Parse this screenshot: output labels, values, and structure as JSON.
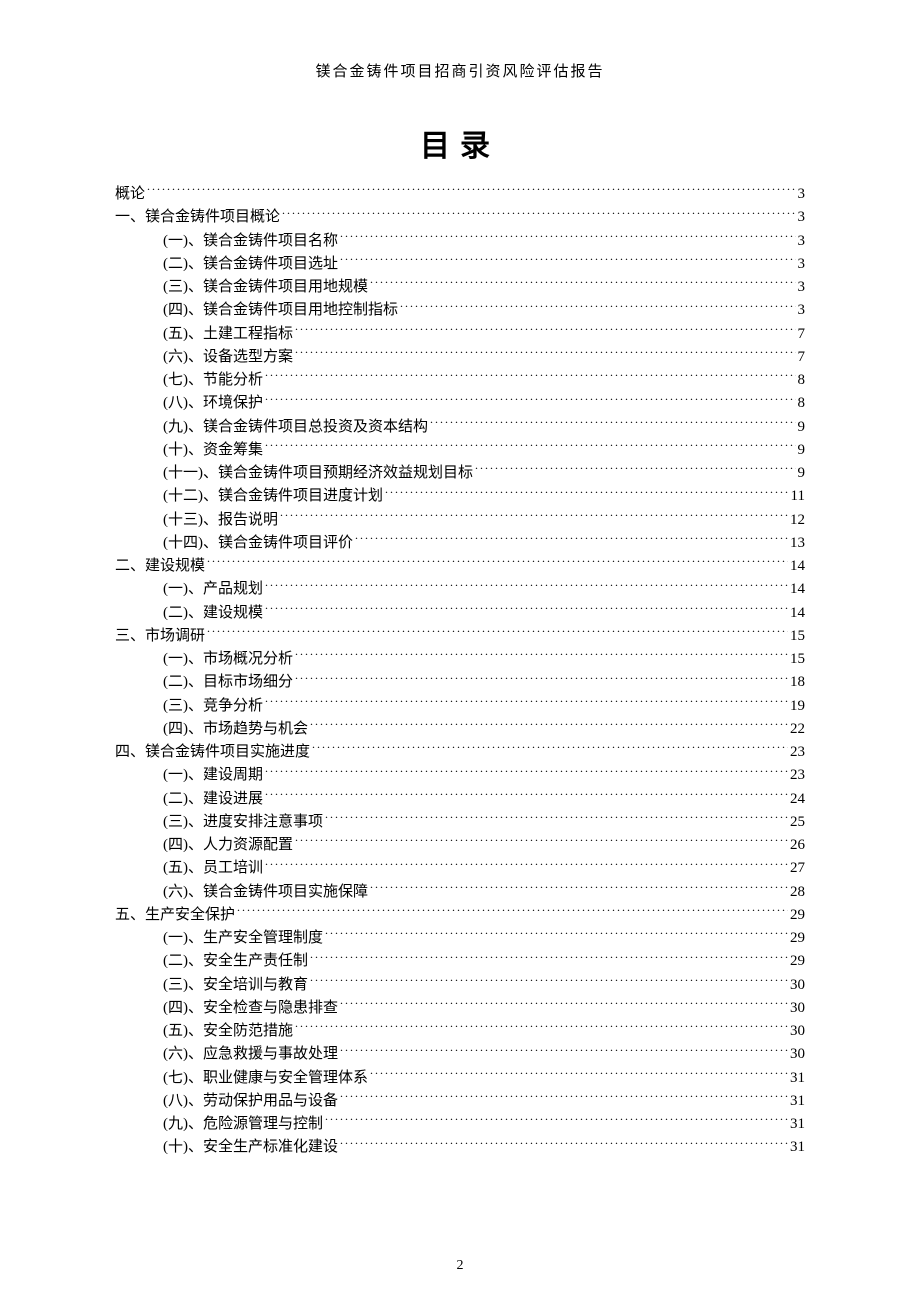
{
  "header": "镁合金铸件项目招商引资风险评估报告",
  "toc_title": "目录",
  "page_number": "2",
  "toc": [
    {
      "level": 0,
      "label": "概论",
      "page": "3"
    },
    {
      "level": 1,
      "label": "一、镁合金铸件项目概论",
      "page": "3"
    },
    {
      "level": 2,
      "label": "(一)、镁合金铸件项目名称",
      "page": "3"
    },
    {
      "level": 2,
      "label": "(二)、镁合金铸件项目选址",
      "page": "3"
    },
    {
      "level": 2,
      "label": "(三)、镁合金铸件项目用地规模",
      "page": "3"
    },
    {
      "level": 2,
      "label": "(四)、镁合金铸件项目用地控制指标",
      "page": "3"
    },
    {
      "level": 2,
      "label": "(五)、土建工程指标",
      "page": "7"
    },
    {
      "level": 2,
      "label": "(六)、设备选型方案",
      "page": "7"
    },
    {
      "level": 2,
      "label": "(七)、节能分析",
      "page": "8"
    },
    {
      "level": 2,
      "label": "(八)、环境保护",
      "page": "8"
    },
    {
      "level": 2,
      "label": "(九)、镁合金铸件项目总投资及资本结构",
      "page": "9"
    },
    {
      "level": 2,
      "label": "(十)、资金筹集",
      "page": "9"
    },
    {
      "level": 2,
      "label": "(十一)、镁合金铸件项目预期经济效益规划目标",
      "page": "9"
    },
    {
      "level": 2,
      "label": "(十二)、镁合金铸件项目进度计划",
      "page": "11"
    },
    {
      "level": 2,
      "label": "(十三)、报告说明",
      "page": "12"
    },
    {
      "level": 2,
      "label": "(十四)、镁合金铸件项目评价",
      "page": "13"
    },
    {
      "level": 1,
      "label": "二、建设规模",
      "page": "14"
    },
    {
      "level": 2,
      "label": "(一)、产品规划",
      "page": "14"
    },
    {
      "level": 2,
      "label": "(二)、建设规模",
      "page": "14"
    },
    {
      "level": 1,
      "label": "三、市场调研",
      "page": "15"
    },
    {
      "level": 2,
      "label": "(一)、市场概况分析",
      "page": "15"
    },
    {
      "level": 2,
      "label": "(二)、目标市场细分",
      "page": "18"
    },
    {
      "level": 2,
      "label": "(三)、竞争分析",
      "page": "19"
    },
    {
      "level": 2,
      "label": "(四)、市场趋势与机会",
      "page": "22"
    },
    {
      "level": 1,
      "label": "四、镁合金铸件项目实施进度",
      "page": "23"
    },
    {
      "level": 2,
      "label": "(一)、建设周期",
      "page": "23"
    },
    {
      "level": 2,
      "label": "(二)、建设进展",
      "page": "24"
    },
    {
      "level": 2,
      "label": "(三)、进度安排注意事项",
      "page": "25"
    },
    {
      "level": 2,
      "label": "(四)、人力资源配置",
      "page": "26"
    },
    {
      "level": 2,
      "label": "(五)、员工培训",
      "page": "27"
    },
    {
      "level": 2,
      "label": "(六)、镁合金铸件项目实施保障",
      "page": "28"
    },
    {
      "level": 1,
      "label": "五、生产安全保护",
      "page": "29"
    },
    {
      "level": 2,
      "label": "(一)、生产安全管理制度",
      "page": "29"
    },
    {
      "level": 2,
      "label": "(二)、安全生产责任制",
      "page": "29"
    },
    {
      "level": 2,
      "label": "(三)、安全培训与教育",
      "page": "30"
    },
    {
      "level": 2,
      "label": "(四)、安全检查与隐患排查",
      "page": "30"
    },
    {
      "level": 2,
      "label": "(五)、安全防范措施",
      "page": "30"
    },
    {
      "level": 2,
      "label": "(六)、应急救援与事故处理",
      "page": "30"
    },
    {
      "level": 2,
      "label": "(七)、职业健康与安全管理体系",
      "page": "31"
    },
    {
      "level": 2,
      "label": "(八)、劳动保护用品与设备",
      "page": "31"
    },
    {
      "level": 2,
      "label": "(九)、危险源管理与控制",
      "page": "31"
    },
    {
      "level": 2,
      "label": "(十)、安全生产标准化建设",
      "page": "31"
    }
  ]
}
